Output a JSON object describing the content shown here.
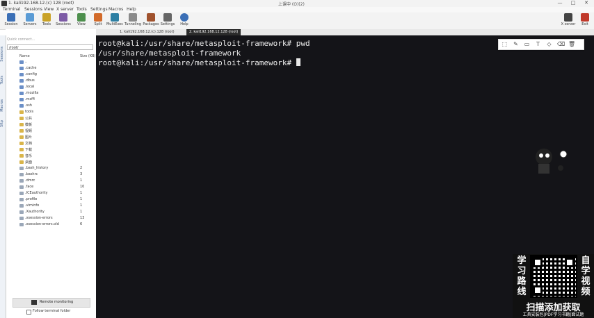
{
  "titlebar": {
    "title": "1. kali192.168.12.(c) 128 (root)",
    "center_text": "上课中  (O)(2)",
    "min": "—",
    "max": "□",
    "close": "✕"
  },
  "menu": [
    "Terminal",
    "Sessions",
    "View",
    "X server",
    "Tools",
    "Settings",
    "Macros",
    "Help"
  ],
  "toolbar": {
    "buttons": [
      "Session",
      "Servers",
      "Tools",
      "Sessions",
      "View",
      "Split",
      "MultiExec",
      "Tunneling",
      "Packages",
      "Settings",
      "Help"
    ],
    "right_buttons": [
      "X server",
      "Exit"
    ]
  },
  "tabs": {
    "tab1": "1. kali192.168.12.(c).128 (root)",
    "tab2": "2. kali192.168.12.128 (root)"
  },
  "sidebar": {
    "quick_connect_placeholder": "Quick connect...",
    "path": "/root/",
    "header_name": "Name",
    "header_size": "Size (KB)",
    "vertical_tabs": [
      "Sessions",
      "Tools",
      "Macros",
      "Sftp"
    ],
    "files": [
      {
        "name": "..",
        "size": ""
      },
      {
        "name": ".cache",
        "size": ""
      },
      {
        "name": ".config",
        "size": ""
      },
      {
        "name": ".dbus",
        "size": ""
      },
      {
        "name": ".local",
        "size": ""
      },
      {
        "name": ".mozilla",
        "size": ""
      },
      {
        "name": ".msf4",
        "size": ""
      },
      {
        "name": ".ssh",
        "size": ""
      },
      {
        "name": "tools",
        "size": ""
      },
      {
        "name": "公共",
        "size": ""
      },
      {
        "name": "模板",
        "size": ""
      },
      {
        "name": "视频",
        "size": ""
      },
      {
        "name": "图片",
        "size": ""
      },
      {
        "name": "文档",
        "size": ""
      },
      {
        "name": "下载",
        "size": ""
      },
      {
        "name": "音乐",
        "size": ""
      },
      {
        "name": "桌面",
        "size": ""
      },
      {
        "name": ".bash_history",
        "size": "2"
      },
      {
        "name": ".bashrc",
        "size": "3"
      },
      {
        "name": ".dmrc",
        "size": "1"
      },
      {
        "name": ".face",
        "size": "10"
      },
      {
        "name": ".ICEauthority",
        "size": "1"
      },
      {
        "name": ".profile",
        "size": "1"
      },
      {
        "name": ".viminfo",
        "size": "1"
      },
      {
        "name": ".Xauthority",
        "size": "1"
      },
      {
        "name": ".xsession-errors",
        "size": "13"
      },
      {
        "name": ".xsession-errors.old",
        "size": "6"
      }
    ],
    "remote_monitoring": "Remote monitoring",
    "follow_terminal": "Follow terminal folder"
  },
  "terminal": {
    "line1": "root@kali:/usr/share/metasploit-framework# pwd",
    "line2": "/usr/share/metasploit-framework",
    "line3": "root@kali:/usr/share/metasploit-framework# "
  },
  "promo": {
    "left_chars": [
      "学",
      "习",
      "路",
      "线"
    ],
    "right_chars": [
      "自",
      "学",
      "视",
      "频"
    ],
    "headline": "扫描添加获取",
    "subline": "工具安装包|PDF学习书籍|面试题"
  },
  "colors": {
    "terminal_bg": "#141418",
    "terminal_fg": "#e8e8e8",
    "active_tab": "#2b2b2b",
    "promo_bg": "#111111"
  }
}
